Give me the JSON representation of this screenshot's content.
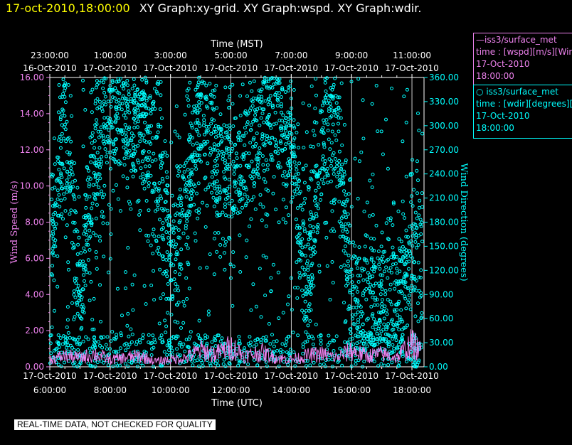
{
  "header": {
    "datetime": "17-oct-2010,18:00:00",
    "title": "XY Graph:xy-grid.  XY Graph:wspd.  XY Graph:wdir."
  },
  "colors": {
    "wspd": "#ee82ee",
    "wdir": "#00ffff",
    "header_date": "#ffff00",
    "grid": "#ffffff",
    "background": "#000000"
  },
  "legend": [
    {
      "symbol": "—",
      "name": "iss3/surface_met",
      "variable": "time : [wspd][m/s][Wind",
      "date": "17-Oct-2010",
      "time": "18:00:00"
    },
    {
      "symbol": "○",
      "name": "iss3/surface_met",
      "variable": "time : [wdir][degrees][V",
      "date": "17-Oct-2010",
      "time": "18:00:00"
    }
  ],
  "footer": "REAL-TIME DATA, NOT CHECKED FOR QUALITY",
  "chart_data": {
    "type": "line",
    "grid": true,
    "top_axis": {
      "label": "Time (MST)",
      "ticks": [
        {
          "time": "23:00:00",
          "date": "16-Oct-2010"
        },
        {
          "time": "1:00:00",
          "date": "17-Oct-2010"
        },
        {
          "time": "3:00:00",
          "date": "17-Oct-2010"
        },
        {
          "time": "5:00:00",
          "date": "17-Oct-2010"
        },
        {
          "time": "7:00:00",
          "date": "17-Oct-2010"
        },
        {
          "time": "9:00:00",
          "date": "17-Oct-2010"
        },
        {
          "time": "11:00:00",
          "date": "17-Oct-2010"
        }
      ]
    },
    "bottom_axis": {
      "label": "Time (UTC)",
      "ticks": [
        {
          "date": "17-Oct-2010",
          "time": "6:00:00"
        },
        {
          "date": "17-Oct-2010",
          "time": "8:00:00"
        },
        {
          "date": "17-Oct-2010",
          "time": "10:00:00"
        },
        {
          "date": "17-Oct-2010",
          "time": "12:00:00"
        },
        {
          "date": "17-Oct-2010",
          "time": "14:00:00"
        },
        {
          "date": "17-Oct-2010",
          "time": "16:00:00"
        },
        {
          "date": "17-Oct-2010",
          "time": "18:00:00"
        }
      ],
      "range_hours_utc": [
        6,
        18.4
      ]
    },
    "left_axis": {
      "label": "Wind Speed (m/s)",
      "ylim": [
        0,
        16
      ],
      "ticks": [
        "0.00",
        "2.00",
        "4.00",
        "6.00",
        "8.00",
        "10.00",
        "12.00",
        "14.00",
        "16.00"
      ]
    },
    "right_axis": {
      "label": "Wind Direction (degrees)",
      "ylim": [
        0,
        360
      ],
      "ticks": [
        "0.00",
        "30.00",
        "60.00",
        "90.00",
        "120.00",
        "150.00",
        "180.00",
        "210.00",
        "240.00",
        "270.00",
        "300.00",
        "330.00",
        "360.00"
      ]
    },
    "series": [
      {
        "name": "iss3/surface_met wspd",
        "style": "line",
        "axis": "left",
        "x_hours_utc": [
          6.0,
          6.5,
          7.0,
          7.5,
          8.0,
          8.5,
          9.0,
          9.5,
          10.0,
          10.5,
          11.0,
          11.5,
          12.0,
          12.5,
          13.0,
          13.5,
          14.0,
          14.5,
          15.0,
          15.5,
          16.0,
          16.5,
          17.0,
          17.5,
          18.0,
          18.3
        ],
        "values": [
          0.4,
          0.6,
          0.5,
          0.7,
          0.4,
          0.5,
          0.6,
          0.3,
          0.4,
          0.5,
          0.9,
          0.7,
          1.1,
          0.6,
          0.8,
          0.5,
          0.4,
          0.6,
          0.7,
          0.5,
          0.9,
          0.6,
          0.7,
          0.5,
          1.3,
          0.8
        ]
      },
      {
        "name": "iss3/surface_met wdir",
        "style": "scatter",
        "axis": "right",
        "sample_x_hours_utc": [
          6.0,
          6.5,
          7.0,
          7.5,
          8.0,
          8.5,
          9.0,
          9.5,
          10.0,
          10.5,
          11.0,
          11.5,
          12.0,
          12.5,
          13.0,
          13.5,
          14.0,
          14.5,
          15.0,
          15.5,
          16.0,
          16.5,
          17.0,
          17.5,
          18.0
        ],
        "sample_values": [
          150,
          300,
          80,
          270,
          320,
          300,
          290,
          270,
          120,
          200,
          330,
          250,
          240,
          260,
          300,
          310,
          280,
          90,
          270,
          300,
          80,
          80,
          90,
          80,
          120
        ]
      }
    ]
  }
}
